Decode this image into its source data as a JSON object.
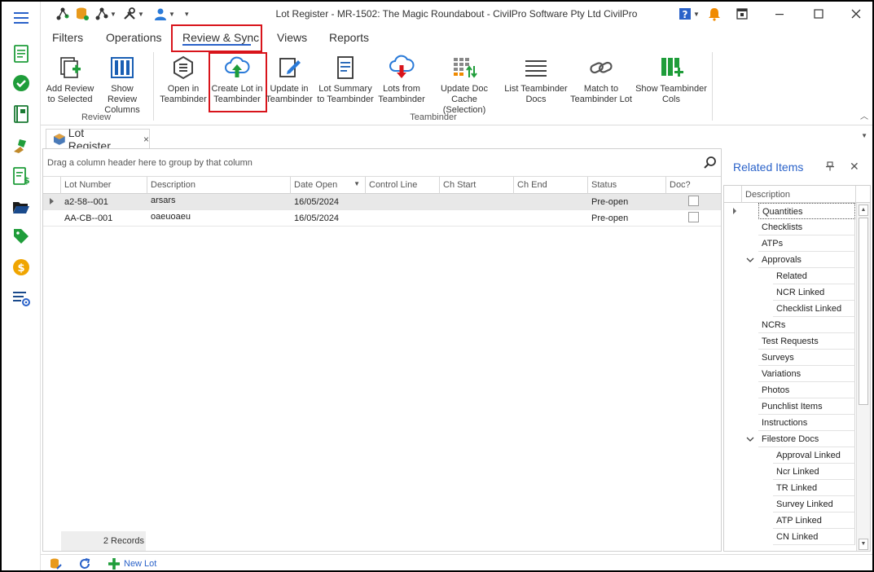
{
  "window": {
    "title": "Lot Register - MR-1502: The Magic Roundabout - CivilPro Software Pty Ltd CivilPro"
  },
  "ribbon_tabs": [
    "Filters",
    "Operations",
    "Review & Sync",
    "Views",
    "Reports"
  ],
  "active_tab": "Review & Sync",
  "ribbon": {
    "review_group_label": "Review",
    "teambinder_group_label": "Teambinder",
    "buttons": [
      {
        "line1": "Add Review",
        "line2": "to Selected"
      },
      {
        "line1": "Show Review",
        "line2": "Columns"
      },
      {
        "line1": "Open in",
        "line2": "Teambinder"
      },
      {
        "line1": "Create Lot in",
        "line2": "Teambinder"
      },
      {
        "line1": "Update in",
        "line2": "Teambinder"
      },
      {
        "line1": "Lot Summary",
        "line2": "to Teambinder"
      },
      {
        "line1": "Lots from",
        "line2": "Teambinder"
      },
      {
        "line1": "Update Doc Cache",
        "line2": "(Selection)"
      },
      {
        "line1": "List Teambinder",
        "line2": "Docs"
      },
      {
        "line1": "Match to",
        "line2": "Teambinder Lot"
      },
      {
        "line1": "Show Teambinder",
        "line2": "Cols"
      }
    ]
  },
  "document_tab": {
    "label": "Lot Register",
    "close": "×"
  },
  "grid": {
    "group_hint": "Drag a column header here to group by that column",
    "columns": [
      "Lot Number",
      "Description",
      "Date Open",
      "Control Line",
      "Ch Start",
      "Ch End",
      "Status",
      "Doc?"
    ],
    "rows": [
      {
        "lot_number": "a2-58--001",
        "description": "arsars",
        "date_open": "16/05/2024",
        "control_line": "",
        "ch_start": "",
        "ch_end": "",
        "status": "Pre-open"
      },
      {
        "lot_number": "AA-CB--001",
        "description": "oaeuoaeu",
        "date_open": "16/05/2024",
        "control_line": "",
        "ch_start": "",
        "ch_end": "",
        "status": "Pre-open"
      }
    ],
    "records_text": "2 Records"
  },
  "related": {
    "title": "Related Items",
    "column_header": "Description",
    "items": [
      {
        "label": "Quantities"
      },
      {
        "label": "Checklists"
      },
      {
        "label": "ATPs"
      },
      {
        "label": "Approvals"
      },
      {
        "label": "Related"
      },
      {
        "label": "NCR Linked"
      },
      {
        "label": "Checklist Linked"
      },
      {
        "label": "NCRs"
      },
      {
        "label": "Test Requests"
      },
      {
        "label": "Surveys"
      },
      {
        "label": "Variations"
      },
      {
        "label": "Photos"
      },
      {
        "label": "Punchlist Items"
      },
      {
        "label": "Instructions"
      },
      {
        "label": "Filestore Docs"
      },
      {
        "label": "Approval Linked"
      },
      {
        "label": "Ncr Linked"
      },
      {
        "label": "TR Linked"
      },
      {
        "label": "Survey Linked"
      },
      {
        "label": "ATP Linked"
      },
      {
        "label": "CN Linked"
      }
    ]
  },
  "statusbar": {
    "new_lot": "New Lot"
  },
  "colors": {
    "accent": "#2a62c9",
    "highlight_box": "#d8141b",
    "green": "#1f9d3a"
  }
}
